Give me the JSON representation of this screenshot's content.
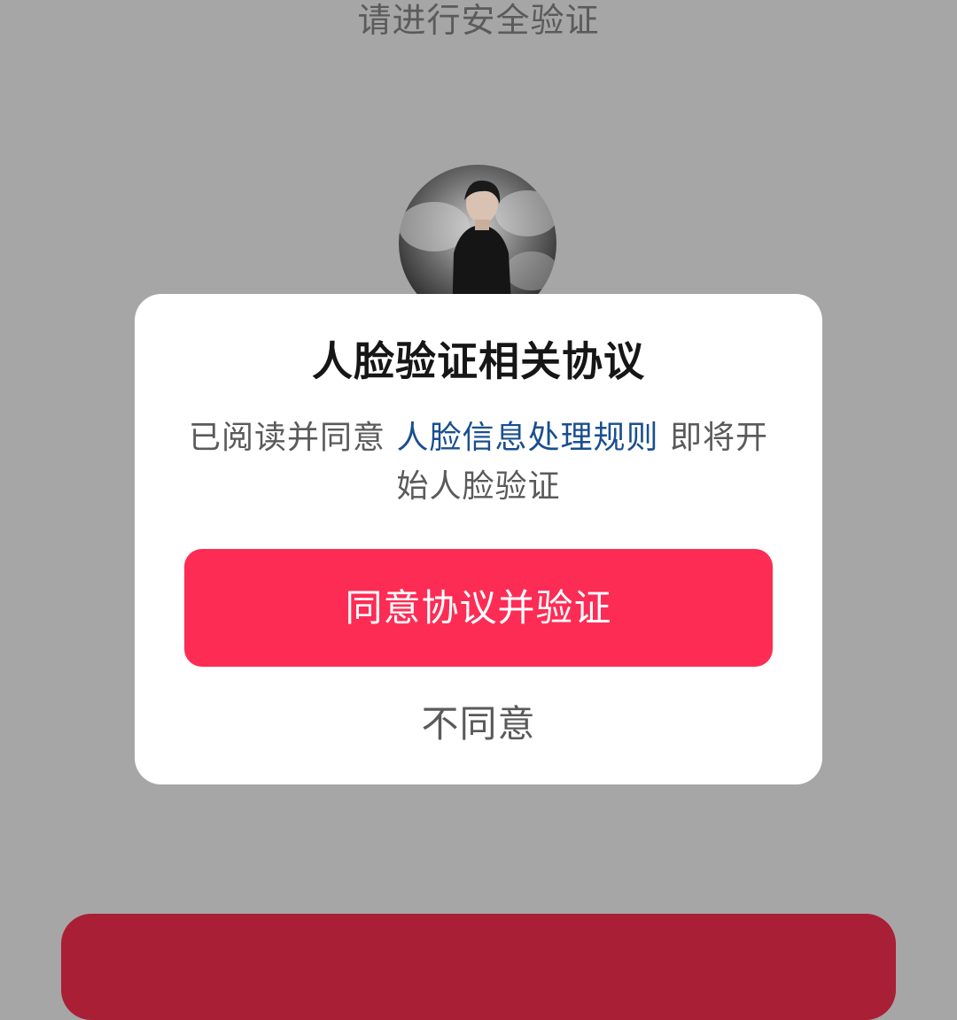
{
  "header": {
    "title": "请进行安全验证"
  },
  "avatar": {
    "description_icon": "user-avatar-photo"
  },
  "dialog": {
    "title": "人脸验证相关协议",
    "message_prefix": "已阅读并同意 ",
    "policy_link": "人脸信息处理规则",
    "message_suffix": " 即将开始人脸验证",
    "agree_label": "同意协议并验证",
    "disagree_label": "不同意"
  },
  "colors": {
    "overlay_background": "#a6a6a6",
    "primary_button": "#fd2c55",
    "bottom_button": "#a91f35",
    "link": "#1a4f8f"
  }
}
